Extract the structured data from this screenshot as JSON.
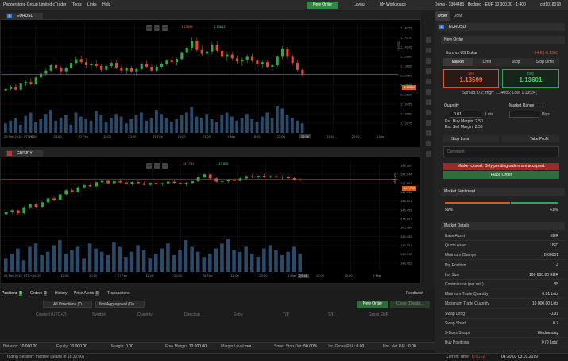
{
  "topbar": {
    "app_title": "Pepperstone Group Limited cTrader",
    "menu": [
      "Tools",
      "Links",
      "Help"
    ],
    "new_order": "New Order",
    "layout": "Layout",
    "workspace": "My Workspace",
    "account": "Demo · 3304480 · Hedged · EUR 10 000.00 · 1:400",
    "user": "ckt1018078"
  },
  "chart1": {
    "symbol": "EURUSD",
    "bid_chip": "1.13599",
    "ask_chip": "1.13613",
    "timeframe": "30 min",
    "current_price": "1.13599",
    "price_ticks": [
      "1.14325",
      "1.14210",
      "1.14095",
      "1.13980",
      "1.13865",
      "1.13750",
      "1.13635",
      "1.13520",
      "1.13405",
      "1.13290",
      "1.13175"
    ],
    "time_ticks": [
      "25 Feb 2019, UTC+2",
      "15:00",
      "23:00",
      "27 Feb",
      "15:00",
      "23:00",
      "28 Feb",
      "15:00",
      "23:00",
      "1 Mar",
      "15:00",
      "23:00",
      "2 Mar",
      "15:00",
      "23:00",
      "3 Mar"
    ],
    "countdown": "29:46",
    "ohlc": [
      [
        1.1339,
        1.1342,
        1.1336,
        1.1341
      ],
      [
        1.1341,
        1.1346,
        1.1339,
        1.1344
      ],
      [
        1.1344,
        1.1347,
        1.1338,
        1.134
      ],
      [
        1.134,
        1.1349,
        1.1339,
        1.1348
      ],
      [
        1.1348,
        1.1352,
        1.1345,
        1.135
      ],
      [
        1.135,
        1.1355,
        1.1346,
        1.1347
      ],
      [
        1.1347,
        1.1357,
        1.1346,
        1.1356
      ],
      [
        1.1356,
        1.1363,
        1.1354,
        1.1361
      ],
      [
        1.1361,
        1.1368,
        1.1358,
        1.1365
      ],
      [
        1.1365,
        1.1374,
        1.1362,
        1.1372
      ],
      [
        1.1372,
        1.1376,
        1.1366,
        1.1368
      ],
      [
        1.1368,
        1.1371,
        1.136,
        1.1364
      ],
      [
        1.1364,
        1.137,
        1.1361,
        1.1368
      ],
      [
        1.1368,
        1.1378,
        1.1366,
        1.1375
      ],
      [
        1.1375,
        1.1383,
        1.1372,
        1.138
      ],
      [
        1.138,
        1.1384,
        1.1374,
        1.1376
      ],
      [
        1.1376,
        1.1381,
        1.1369,
        1.1372
      ],
      [
        1.1372,
        1.1377,
        1.1366,
        1.1374
      ],
      [
        1.1374,
        1.1379,
        1.1369,
        1.1371
      ],
      [
        1.1371,
        1.1374,
        1.1363,
        1.1366
      ],
      [
        1.1366,
        1.1373,
        1.1364,
        1.1371
      ],
      [
        1.1371,
        1.1377,
        1.1368,
        1.1375
      ],
      [
        1.1375,
        1.1378,
        1.1367,
        1.1369
      ],
      [
        1.1369,
        1.1372,
        1.1362,
        1.1365
      ],
      [
        1.1365,
        1.137,
        1.136,
        1.1368
      ],
      [
        1.1368,
        1.1371,
        1.1362,
        1.1364
      ],
      [
        1.1364,
        1.1369,
        1.1358,
        1.1367
      ],
      [
        1.1367,
        1.1375,
        1.1365,
        1.1373
      ],
      [
        1.1373,
        1.1378,
        1.1368,
        1.137
      ],
      [
        1.137,
        1.1373,
        1.1363,
        1.1365
      ],
      [
        1.1365,
        1.1372,
        1.1363,
        1.137
      ],
      [
        1.137,
        1.1376,
        1.1367,
        1.1374
      ],
      [
        1.1374,
        1.138,
        1.1371,
        1.1378
      ],
      [
        1.1378,
        1.1383,
        1.1373,
        1.1376
      ],
      [
        1.1376,
        1.1382,
        1.1372,
        1.138
      ],
      [
        1.138,
        1.139,
        1.1378,
        1.1388
      ],
      [
        1.1388,
        1.1398,
        1.1384,
        1.1395
      ],
      [
        1.1395,
        1.1408,
        1.1391,
        1.1404
      ],
      [
        1.1404,
        1.1408,
        1.1389,
        1.1392
      ],
      [
        1.1392,
        1.1398,
        1.1384,
        1.1387
      ],
      [
        1.1387,
        1.1393,
        1.138,
        1.139
      ],
      [
        1.139,
        1.1402,
        1.1386,
        1.1398
      ],
      [
        1.1398,
        1.1404,
        1.1388,
        1.1391
      ],
      [
        1.1391,
        1.1395,
        1.138,
        1.1383
      ],
      [
        1.1383,
        1.139,
        1.1377,
        1.1386
      ],
      [
        1.1386,
        1.139,
        1.1378,
        1.1381
      ],
      [
        1.1381,
        1.1385,
        1.1374,
        1.1377
      ],
      [
        1.1377,
        1.1382,
        1.1371,
        1.1379
      ],
      [
        1.1379,
        1.1386,
        1.1375,
        1.1383
      ],
      [
        1.1383,
        1.1387,
        1.1376,
        1.1378
      ],
      [
        1.1378,
        1.1381,
        1.137,
        1.1373
      ],
      [
        1.1373,
        1.1378,
        1.1369,
        1.1376
      ],
      [
        1.1376,
        1.1379,
        1.1368,
        1.137
      ],
      [
        1.137,
        1.1374,
        1.1365,
        1.1372
      ],
      [
        1.1372,
        1.1385,
        1.137,
        1.1383
      ],
      [
        1.1383,
        1.1397,
        1.138,
        1.1394
      ],
      [
        1.1394,
        1.1396,
        1.138,
        1.1383
      ],
      [
        1.1383,
        1.1386,
        1.1372,
        1.1375
      ],
      [
        1.1375,
        1.1378,
        1.1364,
        1.1366
      ],
      [
        1.1366,
        1.1368,
        1.1356,
        1.136
      ]
    ],
    "volume": [
      14,
      18,
      22,
      12,
      25,
      30,
      16,
      20,
      28,
      34,
      18,
      22,
      26,
      12,
      30,
      24,
      20,
      18,
      32,
      26,
      16,
      22,
      28,
      24,
      14,
      20,
      26,
      30,
      18,
      22,
      34,
      28,
      22,
      16,
      20,
      26,
      30,
      38,
      24,
      22,
      28,
      20,
      16,
      26,
      30,
      24,
      18,
      22,
      28,
      20,
      16,
      24,
      30,
      22,
      40,
      36,
      26,
      22,
      18,
      14
    ]
  },
  "chart2": {
    "symbol": "GBPJPY",
    "bid_chip": "147.792",
    "ask_chip": "147.806",
    "timeframe": "200 pips",
    "current_price": "147.792",
    "price_ticks": [
      "148.280",
      "147.944",
      "147.603",
      "147.236",
      "146.821",
      "146.455",
      "146.121",
      "145.784",
      "145.453",
      "145.131",
      "144.792",
      "144.463"
    ],
    "time_ticks": [
      "25 Feb 2019, UTC+2",
      "04:00",
      "12:00",
      "20:00",
      "27 Feb",
      "12:00",
      "20:00",
      "28 Feb",
      "12:00",
      "20:00",
      "1 Mar",
      "12:00",
      "20:00",
      "3 Mar"
    ],
    "countdown": "29:46",
    "ohlc": [
      [
        146.05,
        146.2,
        145.95,
        146.15
      ],
      [
        146.15,
        146.3,
        146.05,
        146.25
      ],
      [
        146.25,
        146.28,
        146.02,
        146.1
      ],
      [
        146.1,
        146.45,
        146.05,
        146.4
      ],
      [
        146.4,
        146.6,
        146.3,
        146.55
      ],
      [
        146.55,
        146.62,
        146.35,
        146.42
      ],
      [
        146.42,
        146.7,
        146.38,
        146.65
      ],
      [
        146.65,
        146.9,
        146.6,
        146.85
      ],
      [
        146.85,
        146.95,
        146.7,
        146.78
      ],
      [
        146.78,
        147.1,
        146.72,
        147.05
      ],
      [
        147.05,
        147.3,
        147.0,
        147.25
      ],
      [
        147.25,
        147.35,
        147.1,
        147.18
      ],
      [
        147.18,
        147.45,
        147.12,
        147.4
      ],
      [
        147.4,
        147.58,
        147.32,
        147.5
      ],
      [
        147.5,
        147.6,
        147.4,
        147.45
      ],
      [
        147.45,
        147.7,
        147.4,
        147.65
      ],
      [
        147.65,
        147.8,
        147.55,
        147.72
      ],
      [
        147.72,
        147.78,
        147.55,
        147.6
      ],
      [
        147.6,
        147.75,
        147.52,
        147.7
      ],
      [
        147.7,
        147.82,
        147.6,
        147.64
      ],
      [
        147.64,
        147.72,
        147.5,
        147.58
      ],
      [
        147.58,
        147.7,
        147.5,
        147.66
      ],
      [
        147.66,
        147.74,
        147.55,
        147.6
      ],
      [
        147.6,
        147.68,
        147.48,
        147.52
      ],
      [
        147.52,
        147.65,
        147.45,
        147.62
      ],
      [
        147.62,
        147.7,
        147.52,
        147.56
      ],
      [
        147.56,
        147.64,
        147.46,
        147.6
      ],
      [
        147.6,
        147.72,
        147.55,
        147.68
      ],
      [
        147.68,
        147.75,
        147.58,
        147.62
      ],
      [
        147.62,
        147.7,
        147.52,
        147.58
      ],
      [
        147.58,
        147.66,
        147.48,
        147.62
      ],
      [
        147.62,
        147.74,
        147.56,
        147.7
      ],
      [
        147.7,
        147.95,
        147.66,
        147.9
      ],
      [
        147.9,
        148.1,
        147.85,
        148.05
      ],
      [
        148.05,
        148.08,
        147.8,
        147.85
      ],
      [
        147.85,
        147.9,
        147.62,
        147.68
      ],
      [
        147.68,
        147.75,
        147.55,
        147.7
      ],
      [
        147.7,
        147.82,
        147.62,
        147.78
      ],
      [
        147.78,
        147.86,
        147.68,
        147.72
      ],
      [
        147.72,
        147.9,
        147.68,
        147.85
      ],
      [
        147.85,
        148.02,
        147.8,
        147.96
      ],
      [
        147.96,
        148.05,
        147.86,
        147.92
      ],
      [
        147.92,
        148.0,
        147.84,
        147.98
      ],
      [
        147.98,
        148.06,
        147.88,
        147.92
      ],
      [
        147.92,
        148.02,
        147.86,
        147.96
      ],
      [
        147.96,
        148.04,
        147.86,
        147.9
      ],
      [
        147.9,
        148.0,
        147.82,
        147.94
      ],
      [
        147.94,
        148.0,
        147.82,
        147.86
      ],
      [
        147.86,
        147.92,
        147.74,
        147.8
      ],
      [
        147.8,
        147.86,
        147.7,
        147.79
      ]
    ],
    "volume": [
      16,
      22,
      28,
      14,
      30,
      34,
      20,
      24,
      32,
      38,
      22,
      26,
      30,
      16,
      34,
      28,
      24,
      20,
      36,
      30,
      18,
      24,
      32,
      26,
      16,
      22,
      28,
      34,
      20,
      26,
      38,
      30,
      24,
      18,
      22,
      28,
      34,
      40,
      26,
      24,
      30,
      22,
      18,
      28,
      32,
      26,
      20,
      24,
      30,
      22
    ]
  },
  "right_panel": {
    "tab_order": "Order",
    "tab_dom": "DoM",
    "symbol": "EURUSD",
    "new_order_header": "New Order",
    "instrument_name": "Euro vs US Dollar",
    "change": "-14.6 (-0.13%)",
    "order_types": [
      "Market",
      "Limit",
      "Stop",
      "Stop Limit"
    ],
    "sell_label": "Sell",
    "sell_price": "1.13599",
    "buy_label": "Buy",
    "buy_price": "1.13601",
    "spread_line": "Spread: 0.2; High: 1.14086; Low: 1.13534;",
    "quantity_label": "Quantity",
    "market_range_label": "Market Range",
    "quantity_value": "0.01",
    "lots_label": "Lots",
    "pips_label": "Pips",
    "buy_margin": "Est. Buy Margin: 2.50",
    "sell_margin": "Est. Sell Margin: 2.50",
    "stop_loss": "Stop Loss",
    "take_profit": "Take Profit",
    "comment_placeholder": "Comment",
    "warning": "Market closed. Only pending orders are accepted.",
    "place_order": "Place Order",
    "sentiment_header": "Market Sentiment",
    "sentiment_sell": "59%",
    "sentiment_buy": "41%",
    "details_header": "Market Details",
    "details": [
      {
        "k": "Base Asset",
        "v": "EUR"
      },
      {
        "k": "Quote Asset",
        "v": "USD"
      },
      {
        "k": "Minimum Change",
        "v": "0.00001"
      },
      {
        "k": "Pip Position",
        "v": "4"
      },
      {
        "k": "Lot Size",
        "v": "100 000.00 EUR"
      },
      {
        "k": "Commission (per mil.)",
        "v": "35"
      },
      {
        "k": "Minimum Trade Quantity",
        "v": "0.01 Lots"
      },
      {
        "k": "Maximum Trade Quantity",
        "v": "10 000.00 Lots"
      },
      {
        "k": "Swap Long",
        "v": "-0.91"
      },
      {
        "k": "Swap Short",
        "v": "0.7"
      },
      {
        "k": "3-Days Swaps",
        "v": "Wednesday"
      },
      {
        "k": "Buy Positions",
        "v": "0 (0 Lots)"
      }
    ]
  },
  "bottom": {
    "tabs": [
      "Positions",
      "Orders",
      "History",
      "Price Alerts",
      "Transactions"
    ],
    "positions_count": "0",
    "orders_count": "0",
    "alerts_count": "0",
    "feedback": "Feedback",
    "filter1": "All Directions (D...",
    "filter2": "Not Aggregated (De...",
    "new_order": "New Order",
    "close_disabled": "Close (Disabl...",
    "columns": [
      "Created (UTC+2)",
      "Symbol",
      "Quantity",
      "Direction",
      "Entry",
      "T/P",
      "S/L",
      "Gross EUR"
    ],
    "status": {
      "balance_label": "Balance:",
      "balance": "10 000.00",
      "equity_label": "Equity:",
      "equity": "10 000.00",
      "margin_label": "Margin:",
      "margin": "0.00",
      "free_margin_label": "Free Margin:",
      "free_margin": "10 000.00",
      "margin_level_label": "Margin Level:",
      "margin_level": "n/a",
      "smart_stop_label": "Smart Stop Out:",
      "smart_stop": "50.00%",
      "unr_gross_label": "Unr. Gross P&L:",
      "unr_gross": "0.00",
      "unr_net_label": "Unr. Net P&L:",
      "unr_net": "0.00"
    }
  },
  "footer": {
    "session": "Trading Session: Inactive (Starts in 18:30:00)",
    "time_label": "Current Time:",
    "tz": "UTC+2",
    "clock": "04:30:03 03.03.2019"
  },
  "colors": {
    "bull": "#2ea84a",
    "bear": "#e04a2a",
    "accent": "#2d8a3e",
    "price_line": "#e05a1e"
  }
}
